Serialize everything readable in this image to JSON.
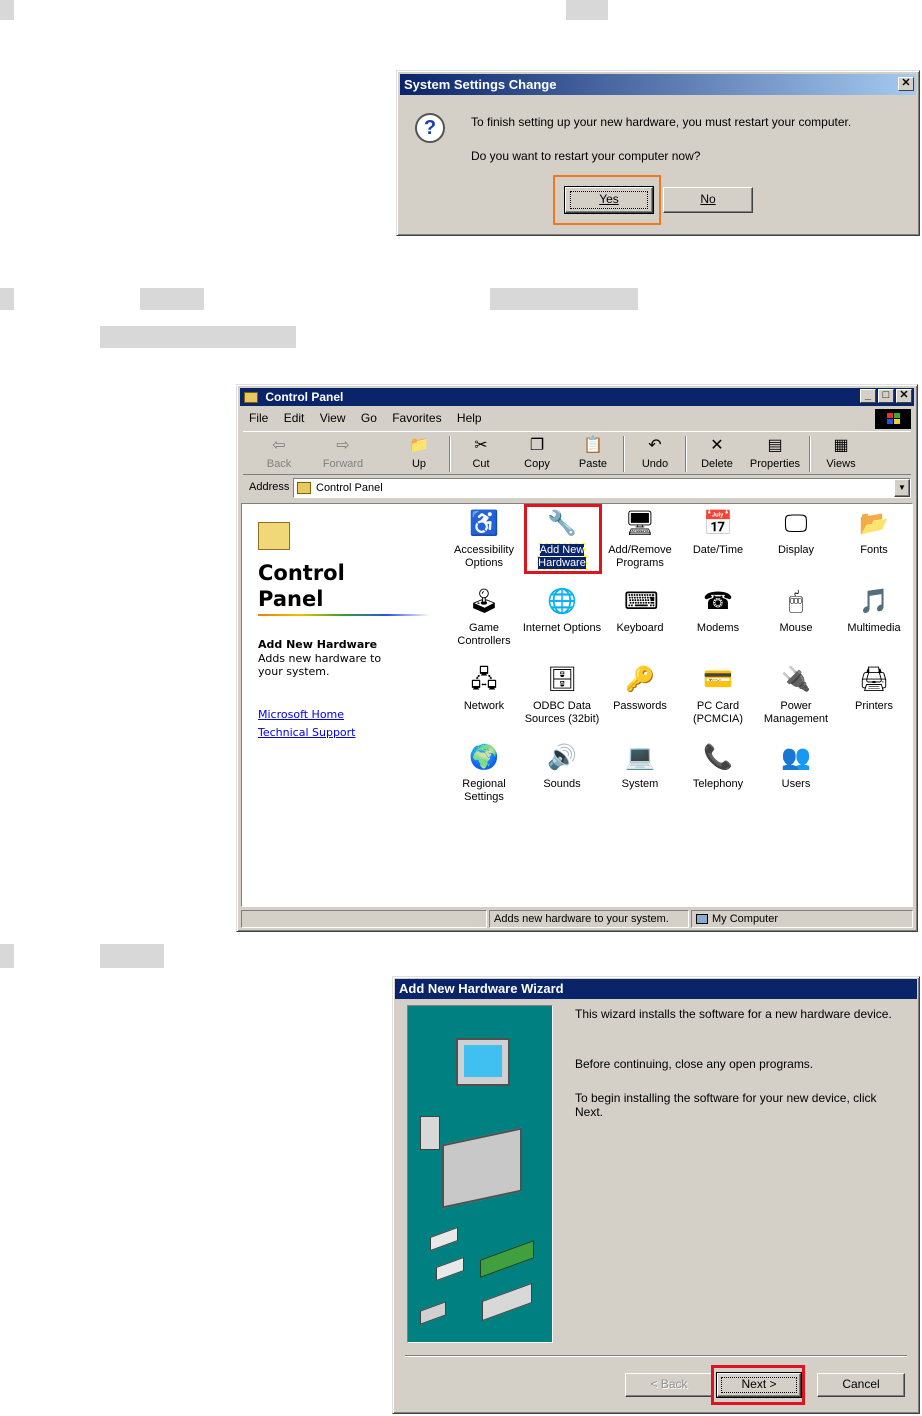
{
  "dialog1": {
    "title": "System Settings Change",
    "close": "✕",
    "message1": "To finish setting up your new hardware, you must restart your computer.",
    "message2": "Do you want to restart your computer now?",
    "yes": "Yes",
    "no": "No",
    "icon": "question-icon"
  },
  "control_panel": {
    "title": "Control Panel",
    "window_buttons": [
      "_",
      "□",
      "✕"
    ],
    "menu": [
      "File",
      "Edit",
      "View",
      "Go",
      "Favorites",
      "Help"
    ],
    "toolbar": [
      "Back",
      "Forward",
      "Up",
      "Cut",
      "Copy",
      "Paste",
      "Undo",
      "Delete",
      "Properties",
      "Views"
    ],
    "address_label": "Address",
    "address_value": "Control Panel",
    "panel_title": "Control Panel",
    "selected_name": "Add New Hardware",
    "selected_desc": "Adds new hardware to your system.",
    "links": [
      "Microsoft Home",
      "Technical Support"
    ],
    "items": [
      "Accessibility Options",
      "Add New Hardware",
      "Add/Remove Programs",
      "Date/Time",
      "Display",
      "Fonts",
      "Game Controllers",
      "Internet Options",
      "Keyboard",
      "Modems",
      "Mouse",
      "Multimedia",
      "Network",
      "ODBC Data Sources (32bit)",
      "Passwords",
      "PC Card (PCMCIA)",
      "Power Management",
      "Printers",
      "Regional Settings",
      "Sounds",
      "System",
      "Telephony",
      "Users"
    ],
    "status_text": "Adds new hardware to your system.",
    "status_zone": "My Computer"
  },
  "wizard": {
    "title": "Add New Hardware Wizard",
    "p1": "This wizard installs the software for a new hardware device.",
    "p2": "Before continuing, close any open programs.",
    "p3": "To begin installing the software for your new device, click Next.",
    "back": "< Back",
    "next": "Next >",
    "cancel": "Cancel"
  },
  "colors": {
    "title_active": "#0a246a",
    "face": "#d4d0c8",
    "highlight_orange": "#f07820",
    "highlight_red": "#e0141e",
    "wizard_teal": "#008080"
  }
}
